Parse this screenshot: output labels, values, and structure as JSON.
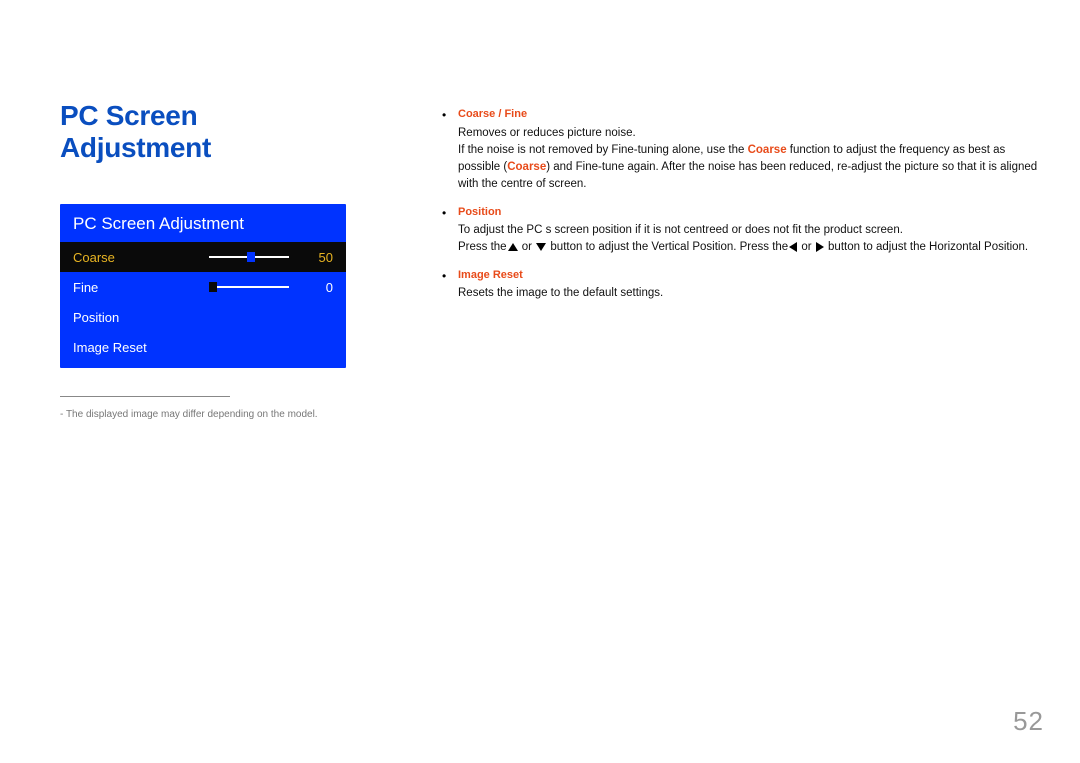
{
  "page": {
    "title": "PC Screen Adjustment",
    "number": "52",
    "footnote": "The displayed image may differ depending on the model."
  },
  "osd": {
    "title": "PC Screen Adjustment",
    "rows": {
      "coarse": {
        "label": "Coarse",
        "value": "50"
      },
      "fine": {
        "label": "Fine",
        "value": "0"
      },
      "position": {
        "label": "Position"
      },
      "imageReset": {
        "label": "Image Reset"
      }
    }
  },
  "descriptions": {
    "coarseFine": {
      "title": "Coarse / Fine",
      "line1": "Removes or reduces picture noise.",
      "line2_a": "If the noise is not removed by Fine-tuning alone, use the ",
      "line2_orange": "Coarse",
      "line2_b": " function to adjust the frequency as best as possible (",
      "line2_orange2": "Coarse",
      "line2_c": ") and Fine-tune again. After the noise has been reduced, re-adjust the picture so that it is aligned with the centre of screen."
    },
    "position": {
      "title": "Position",
      "body": "To adjust the PC s screen position if it is not centreed or does not fit the product screen.",
      "press_a": "Press the",
      "press_mid": " or ",
      "press_b": " button to adjust the Vertical Position. Press the",
      "press_c": " button to adjust the Horizontal Position."
    },
    "imageReset": {
      "title": "Image Reset",
      "body": "Resets the image to the default settings."
    }
  }
}
